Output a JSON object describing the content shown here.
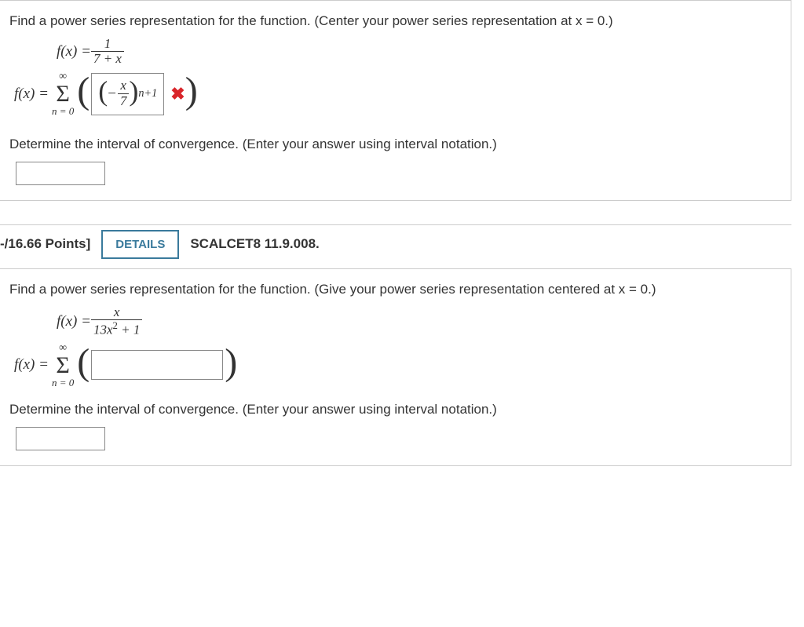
{
  "q1": {
    "prompt": "Find a power series representation for the function. (Center your power series representation at x = 0.)",
    "func_lhs": "f(x) = ",
    "frac_num": "1",
    "frac_den": "7 + x",
    "answer_lhs": "f(x) = ",
    "sigma_top": "∞",
    "sigma_sym": "Σ",
    "sigma_bot": "n = 0",
    "entered_inner_num": "x",
    "entered_inner_den": "7",
    "entered_exp": "n+1",
    "wrong_mark": "✖",
    "interval_prompt": "Determine the interval of convergence. (Enter your answer using interval notation.)"
  },
  "hdr": {
    "points": "-/16.66 Points]",
    "details": "DETAILS",
    "ref": "SCALCET8 11.9.008."
  },
  "q2": {
    "prompt": "Find a power series representation for the function. (Give your power series representation centered at x = 0.)",
    "func_lhs": "f(x) = ",
    "frac_num": "x",
    "frac_den_a": "13x",
    "frac_den_exp": "2",
    "frac_den_b": " + 1",
    "answer_lhs": "f(x) = ",
    "sigma_top": "∞",
    "sigma_sym": "Σ",
    "sigma_bot": "n = 0",
    "interval_prompt": "Determine the interval of convergence. (Enter your answer using interval notation.)"
  }
}
